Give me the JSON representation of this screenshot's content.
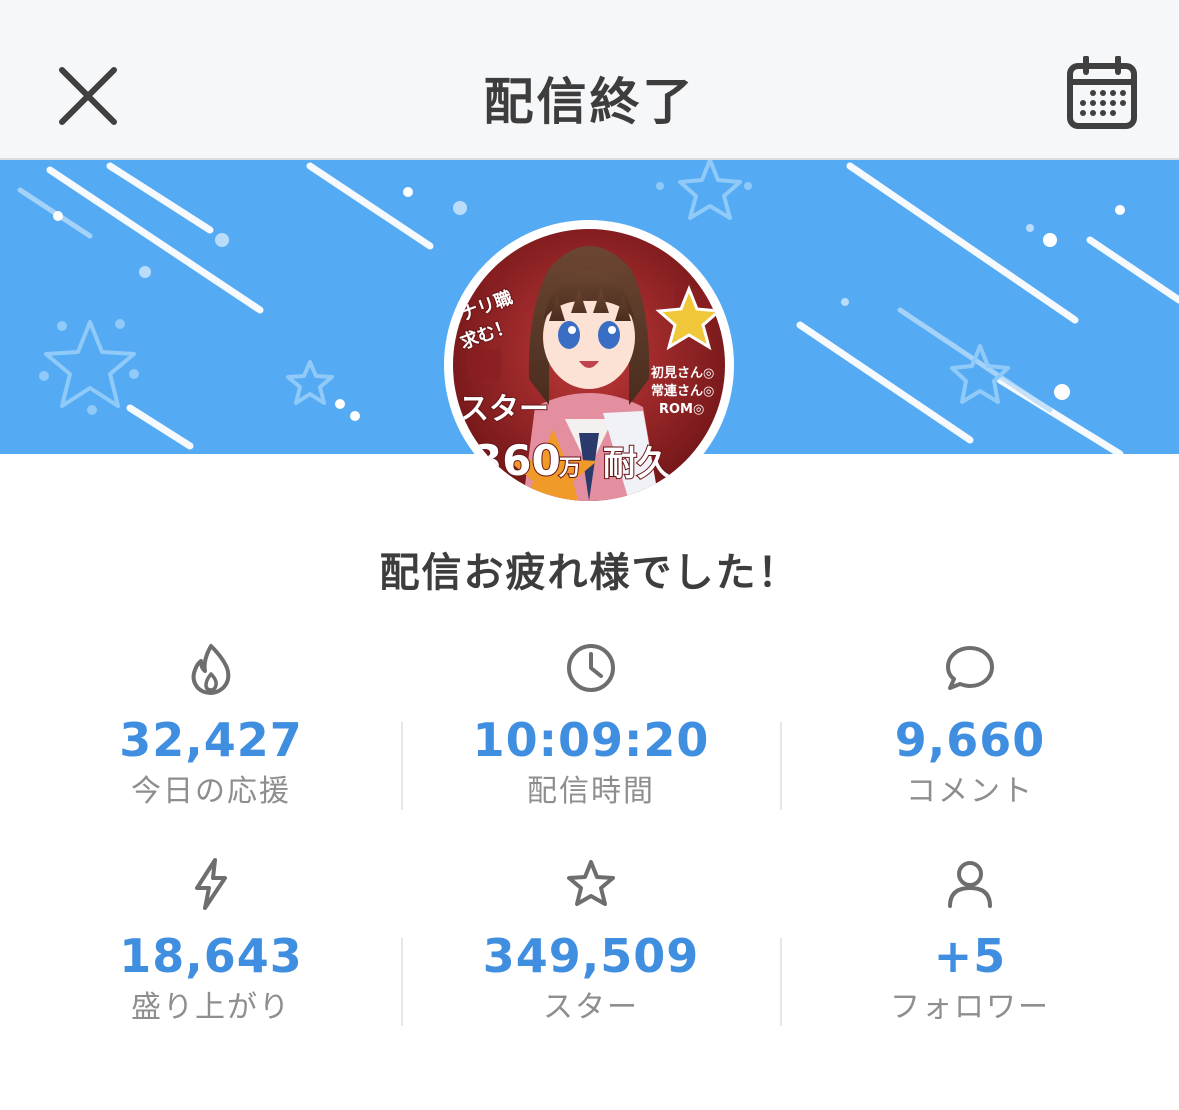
{
  "header": {
    "title": "配信終了",
    "close_icon": "close-icon",
    "calendar_icon": "calendar-icon"
  },
  "banner": {
    "background_color": "#55aaf4"
  },
  "greeting": "配信お疲れ様でした！",
  "stats": [
    {
      "icon": "flame-icon",
      "value": "32,427",
      "label": "今日の応援"
    },
    {
      "icon": "clock-icon",
      "value": "10:09:20",
      "label": "配信時間"
    },
    {
      "icon": "comment-icon",
      "value": "9,660",
      "label": "コメント"
    },
    {
      "icon": "lightning-icon",
      "value": "18,643",
      "label": "盛り上がり"
    },
    {
      "icon": "star-icon",
      "value": "349,509",
      "label": "スター"
    },
    {
      "icon": "person-icon",
      "value": "+5",
      "label": "フォロワー"
    }
  ],
  "colors": {
    "value_blue": "#3f8ee0",
    "label_gray": "#8e8e8e",
    "icon_gray": "#6e6e6e",
    "title_dark": "#3d3d3d"
  }
}
